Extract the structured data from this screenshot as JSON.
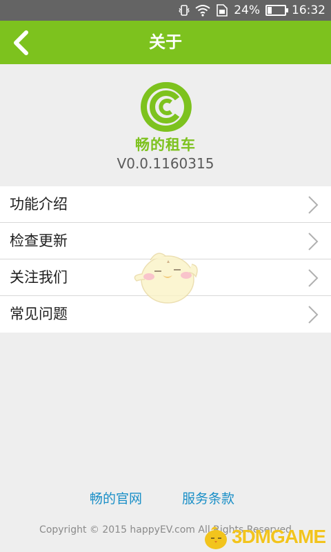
{
  "status_bar": {
    "battery_text": "24%",
    "battery_level": 0.24,
    "time": "16:32",
    "icons": [
      "vibrate-icon",
      "wifi-icon",
      "sim-icon",
      "battery-icon"
    ]
  },
  "header": {
    "title": "关于",
    "back_icon": "chevron-left-icon",
    "color": "#7dc21e"
  },
  "about": {
    "logo_icon": "app-logo-icon",
    "brand_name": "畅的租车",
    "version": "V0.0.1160315"
  },
  "menu": {
    "items": [
      {
        "label": "功能介绍"
      },
      {
        "label": "检查更新"
      },
      {
        "label": "关注我们"
      },
      {
        "label": "常见问题"
      }
    ],
    "item_icon": "chevron-right-icon"
  },
  "footer": {
    "website_link": "畅的官网",
    "terms_link": "服务条款",
    "copyright": "Copyright © 2015 happyEV.com All Rights Reserved",
    "link_color": "#1a8fc7"
  },
  "watermark": {
    "text": "3DMGAME"
  }
}
